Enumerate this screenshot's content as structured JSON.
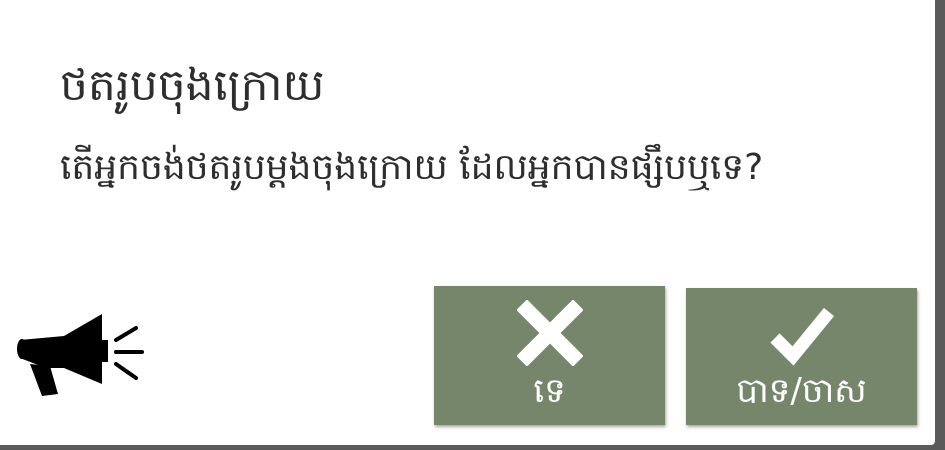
{
  "dialog": {
    "title": "ថតរូបចុងក្រោយ",
    "message": "តើអ្នកចង់ថតរូបម្តងចុងក្រោយ ដែលអ្នកបានផ្សឹបឬទេ?"
  },
  "speaker": {
    "icon": "megaphone-icon"
  },
  "buttons": {
    "no": {
      "label": "ទេ",
      "icon": "close-x-icon"
    },
    "yes": {
      "label": "បាទ/ចាស",
      "icon": "checkmark-icon"
    }
  },
  "colors": {
    "button_bg": "#76866a",
    "dialog_bg": "#ffffff",
    "overlay_bg": "#5a5a5a",
    "text": "#2e2e2e"
  }
}
